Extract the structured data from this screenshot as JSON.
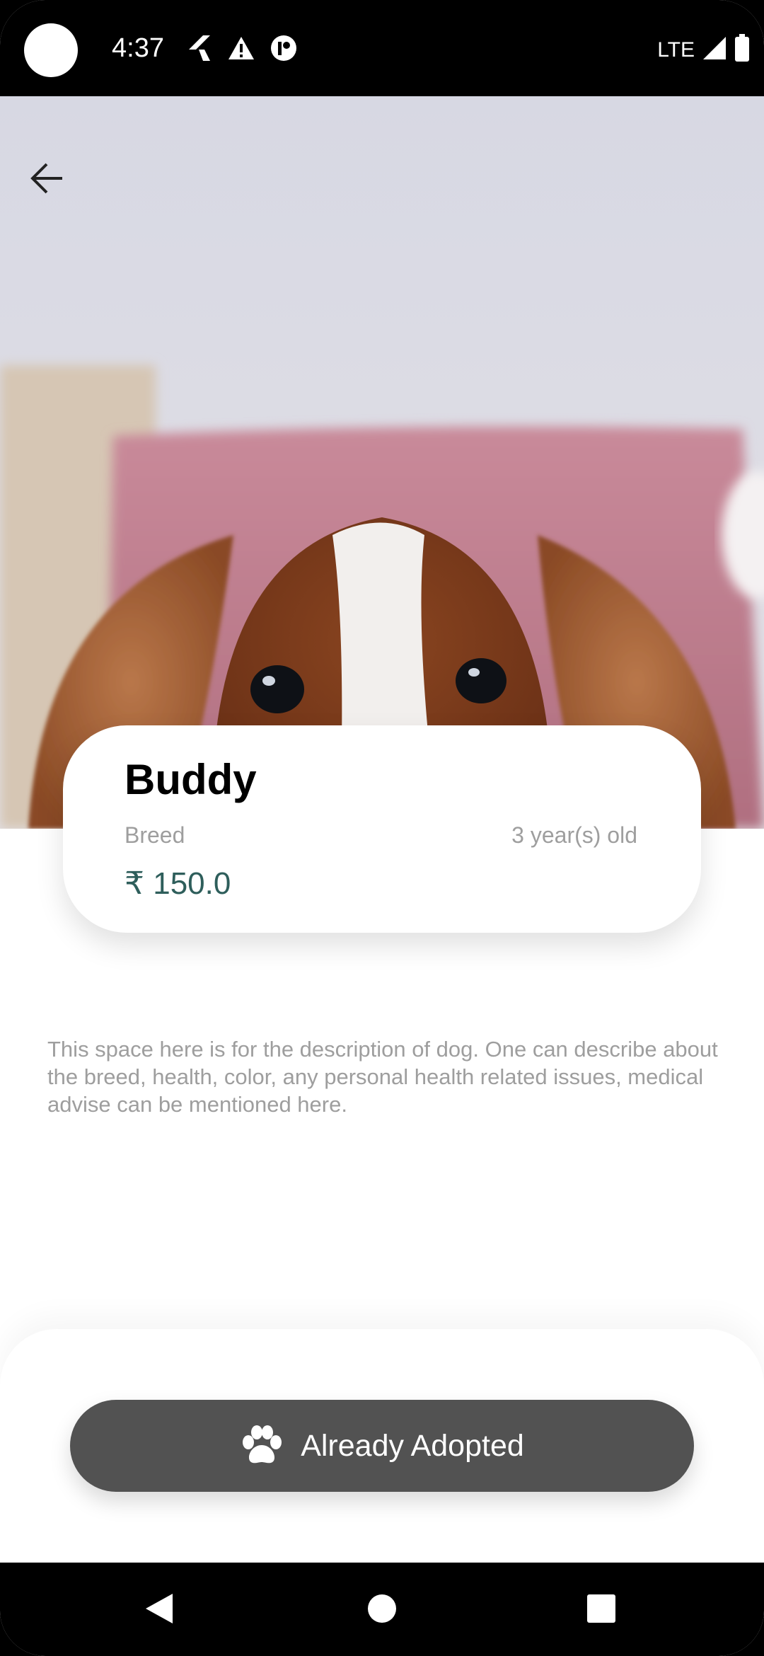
{
  "status_bar": {
    "time": "4:37",
    "network": "LTE",
    "icons": [
      "flutter-icon",
      "warning-icon",
      "app-notification-icon",
      "signal-icon",
      "battery-icon"
    ]
  },
  "hero": {
    "image": "dog-photo",
    "back_icon": "arrow-back-icon"
  },
  "pet": {
    "name": "Buddy",
    "breed": "Breed",
    "age": "3 year(s) old",
    "price": "₹ 150.0"
  },
  "description": "This space here is for the description of dog. One can describe about the breed, health, color, any personal health related issues, medical advise can be mentioned here.",
  "action": {
    "label": "Already Adopted",
    "icon": "paw-icon",
    "color": "#525252"
  },
  "nav_bar": {
    "icons": [
      "back-triangle-icon",
      "home-circle-icon",
      "recents-square-icon"
    ]
  },
  "colors": {
    "price": "#2e5e5b",
    "secondary_text": "#9e9e9e",
    "button": "#525252"
  }
}
